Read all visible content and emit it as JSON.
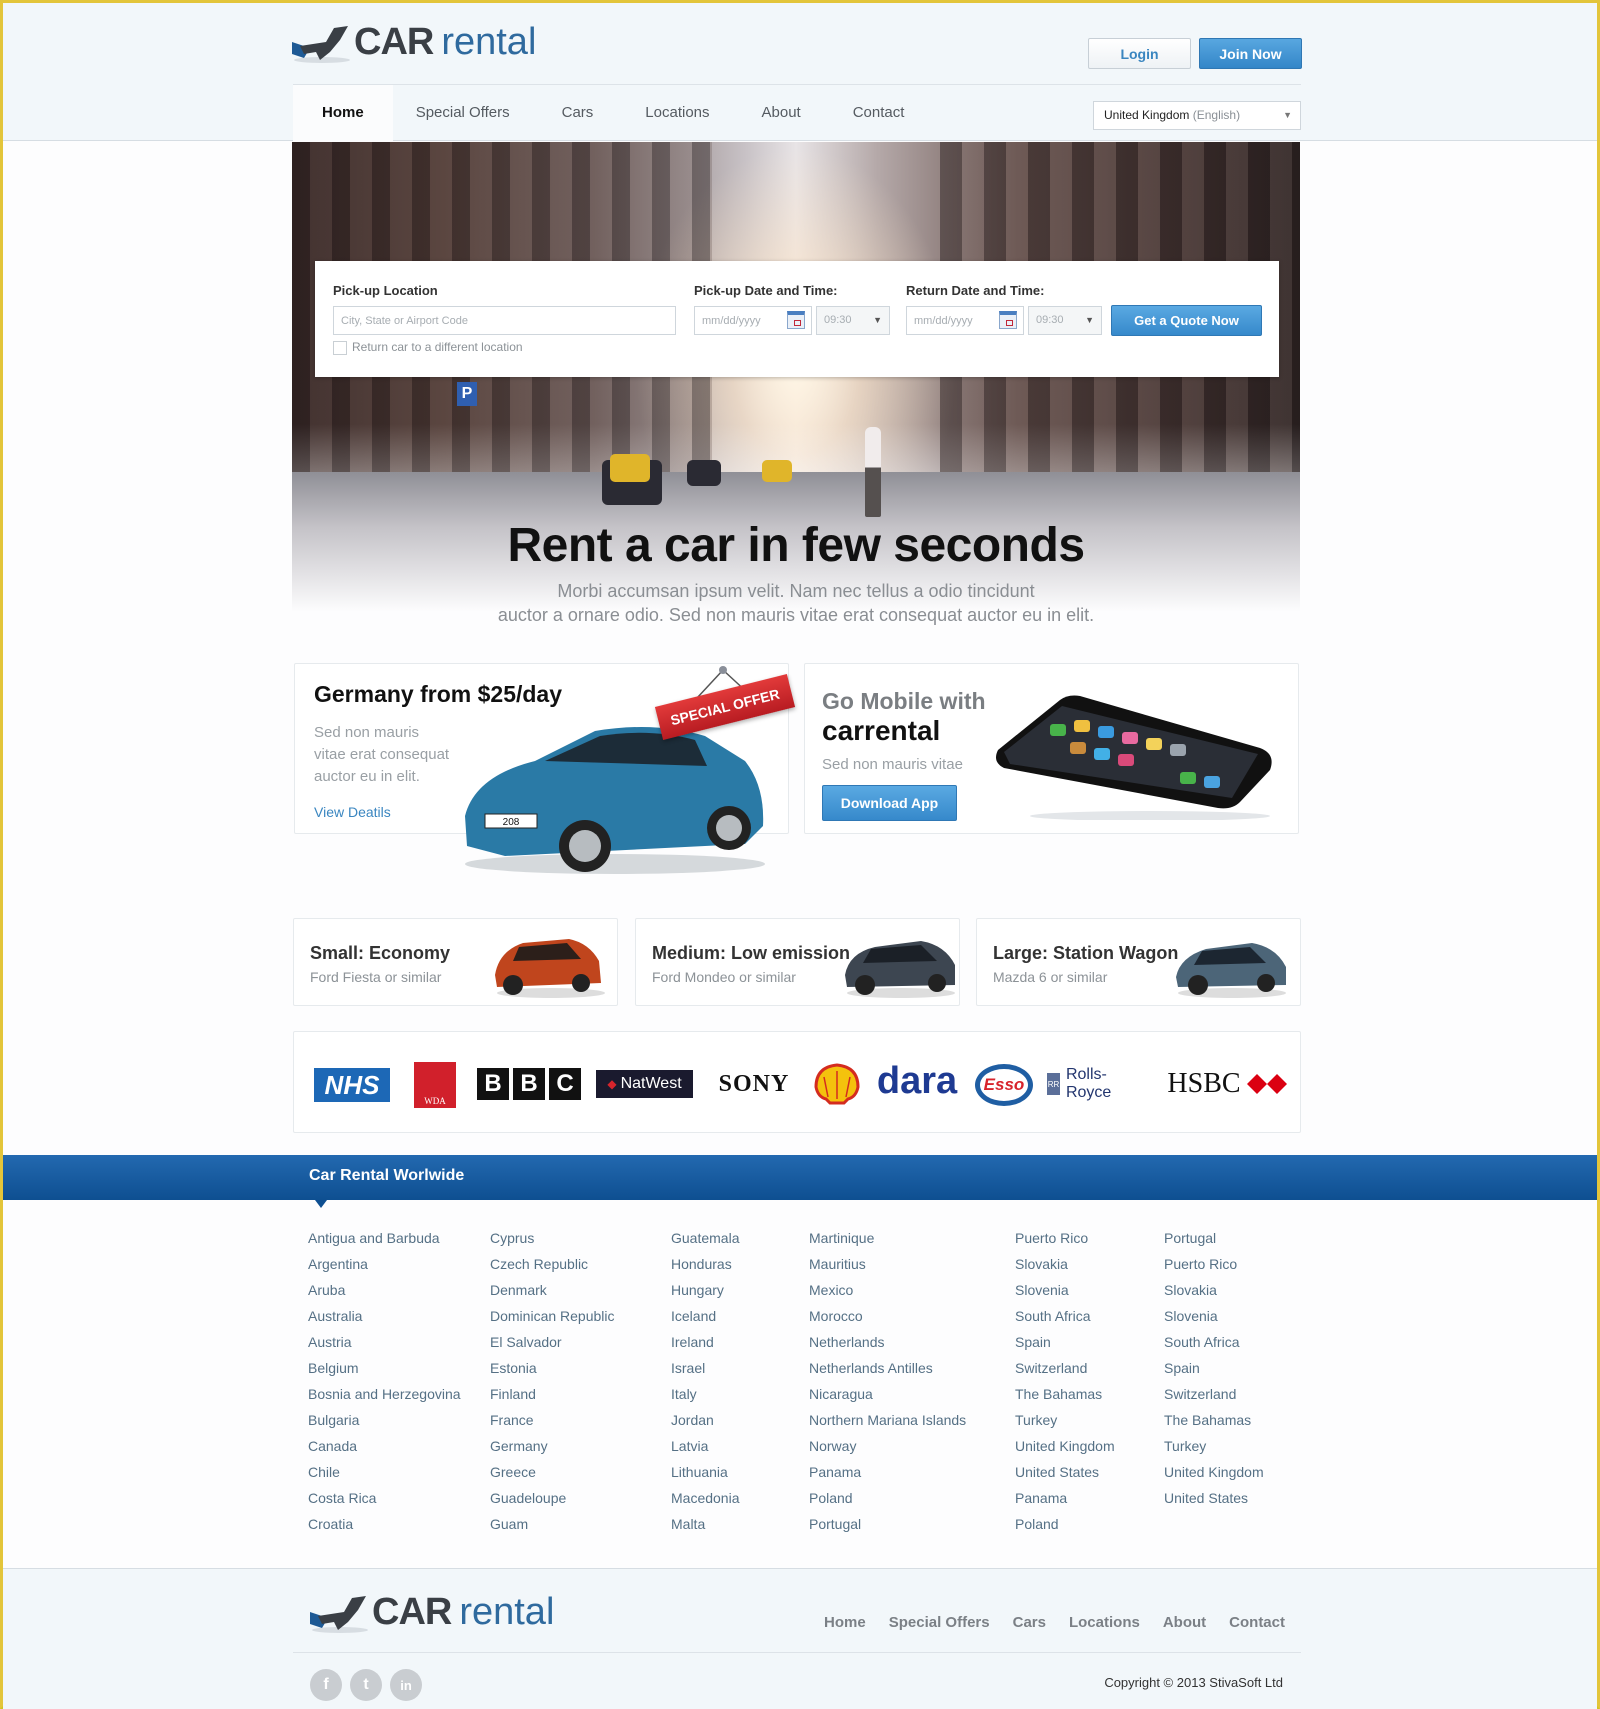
{
  "brand": {
    "car": "CAR",
    "rental": "rental"
  },
  "header": {
    "login_label": "Login",
    "join_label": "Join Now",
    "nav": [
      {
        "label": "Home",
        "active": true
      },
      {
        "label": "Special Offers",
        "active": false
      },
      {
        "label": "Cars",
        "active": false
      },
      {
        "label": "Locations",
        "active": false
      },
      {
        "label": "About",
        "active": false
      },
      {
        "label": "Contact",
        "active": false
      }
    ],
    "language": {
      "country": "United Kingdom",
      "language": "(English)"
    }
  },
  "booking": {
    "pickup_location_label": "Pick-up Location",
    "pickup_location_placeholder": "City, State or Airport Code",
    "return_different_label": "Return car to a different  location",
    "pickup_datetime_label": "Pick-up Date and Time:",
    "pickup_date_placeholder": "mm/dd/yyyy",
    "pickup_time": "09:30",
    "return_datetime_label": "Return Date and Time:",
    "return_date_placeholder": "mm/dd/yyyy",
    "return_time": "09:30",
    "quote_label": "Get a Quote Now"
  },
  "hero": {
    "title": "Rent a car in few seconds",
    "subtitle_line1": "Morbi accumsan ipsum velit. Nam nec tellus a odio tincidunt",
    "subtitle_line2": "auctor a ornare odio. Sed non  mauris vitae erat consequat auctor eu in elit."
  },
  "promo_offer": {
    "title": "Germany from $25/day",
    "desc_lines": [
      "Sed non  mauris",
      "vitae erat consequat",
      "auctor eu in elit."
    ],
    "link": "View Deatils",
    "tag": "SPECIAL OFFER",
    "plate": "208"
  },
  "promo_mobile": {
    "title_line1": "Go Mobile with",
    "title_line2": "carrental",
    "desc": "Sed non  mauris vitae",
    "button": "Download App"
  },
  "categories": [
    {
      "title": "Small: Economy",
      "subtitle": "Ford Fiesta or similar",
      "color": "#c0451d"
    },
    {
      "title": "Medium: Low emission",
      "subtitle": "Ford Mondeo or similar",
      "color": "#3d4651"
    },
    {
      "title": "Large: Station Wagon",
      "subtitle": "Mazda 6 or similar",
      "color": "#4c6578"
    }
  ],
  "partners": {
    "nhs": "NHS",
    "wda": "WDA",
    "bbc": [
      "B",
      "B",
      "C"
    ],
    "natwest": "NatWest",
    "sony": "SONY",
    "dara": "dara",
    "esso": "Esso",
    "rolls_royce": "Rolls-Royce",
    "hsbc": "HSBC"
  },
  "worldwide": {
    "title": "Car Rental Worlwide",
    "columns": [
      [
        "Antigua and Barbuda",
        "Argentina",
        "Aruba",
        "Australia",
        "Austria",
        "Belgium",
        "Bosnia and Herzegovina",
        "Bulgaria",
        "Canada",
        "Chile",
        "Costa Rica",
        "Croatia"
      ],
      [
        "Cyprus",
        "Czech Republic",
        "Denmark",
        "Dominican Republic",
        "El Salvador",
        "Estonia",
        "Finland",
        "France",
        "Germany",
        "Greece",
        "Guadeloupe",
        "Guam"
      ],
      [
        "Guatemala",
        "Honduras",
        "Hungary",
        "Iceland",
        "Ireland",
        "Israel",
        "Italy",
        "Jordan",
        "Latvia",
        "Lithuania",
        "Macedonia",
        "Malta"
      ],
      [
        "Martinique",
        "Mauritius",
        "Mexico",
        "Morocco",
        "Netherlands",
        "Netherlands Antilles",
        "Nicaragua",
        "Northern Mariana Islands",
        "Norway",
        "Panama",
        "Poland",
        "Portugal"
      ],
      [
        "Puerto Rico",
        "Slovakia",
        "Slovenia",
        "South Africa",
        "Spain",
        "Switzerland",
        "The Bahamas",
        "Turkey",
        "United Kingdom",
        "United States",
        "Panama",
        "Poland"
      ],
      [
        "Portugal",
        "Puerto Rico",
        "Slovakia",
        "Slovenia",
        "South Africa",
        "Spain",
        "Switzerland",
        "The Bahamas",
        "Turkey",
        "United Kingdom",
        "United States"
      ]
    ]
  },
  "footer": {
    "nav": [
      "Home",
      "Special Offers",
      "Cars",
      "Locations",
      "About",
      "Contact"
    ],
    "social": [
      {
        "name": "facebook",
        "glyph": "f"
      },
      {
        "name": "twitter",
        "glyph": "t"
      },
      {
        "name": "linkedin",
        "glyph": "in"
      }
    ],
    "copyright": "Copyright © 2013 StivaSoft Ltd"
  },
  "colors": {
    "accent": "#3a86c0",
    "band": "#1a5fa3",
    "brand_blue": "#2f6a9e",
    "special_red": "#d02a2f"
  }
}
